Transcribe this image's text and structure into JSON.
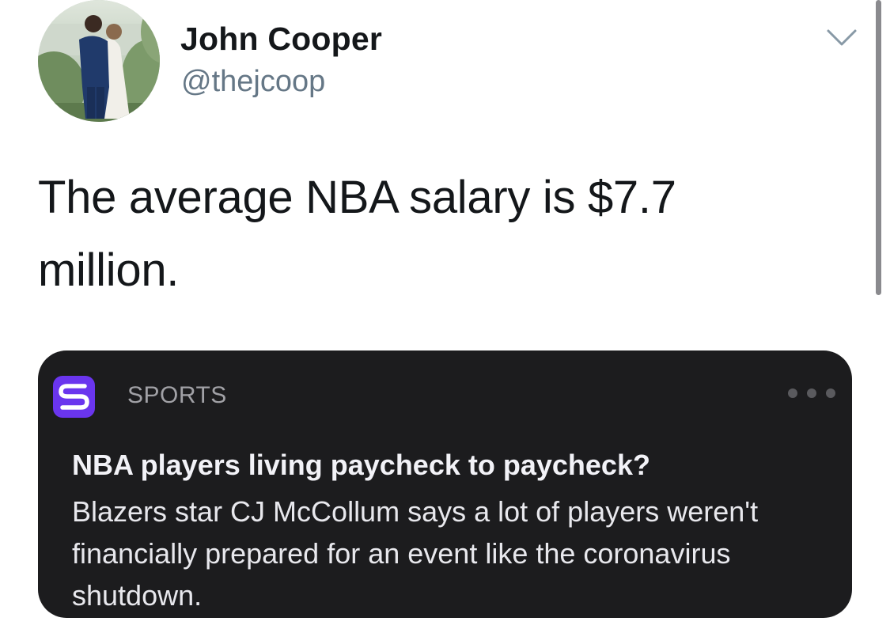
{
  "tweet": {
    "author": {
      "display_name": "John Cooper",
      "handle": "@thejcoop"
    },
    "text": "The average NBA salary is $7.7 million.",
    "menu_icon": "chevron-down-icon"
  },
  "embedded_notification": {
    "app_icon": "sports-s-icon",
    "app_name": "SPORTS",
    "more_icon": "ellipsis-icon",
    "headline": "NBA players living paycheck to paycheck?",
    "body": "Blazers star CJ McCollum says a lot of players weren't financially prepared for an event like the coronavirus shutdown."
  },
  "colors": {
    "card_background": "#1c1c1e",
    "app_icon_background": "#6a35ee",
    "handle_gray": "#657786"
  }
}
